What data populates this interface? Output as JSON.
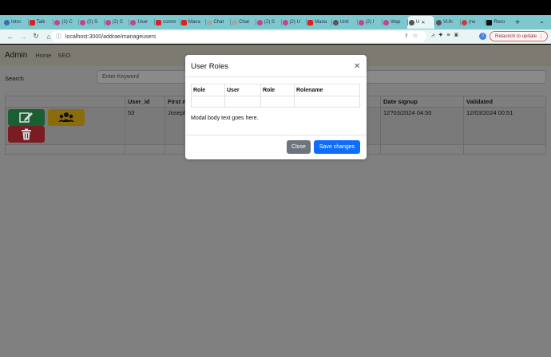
{
  "tabs": [
    {
      "label": "Intro",
      "icon": "globe-icon",
      "color": "#3a6ea5"
    },
    {
      "label": "Talk",
      "icon": "youtube-icon",
      "color": "#e02020"
    },
    {
      "label": "(2) C",
      "icon": "app-icon",
      "color": "#c0468a"
    },
    {
      "label": "(2) S",
      "icon": "app-icon",
      "color": "#c0468a"
    },
    {
      "label": "(2) C",
      "icon": "app-icon",
      "color": "#c0468a"
    },
    {
      "label": "User",
      "icon": "app-icon",
      "color": "#c0468a"
    },
    {
      "label": "comm",
      "icon": "youtube-icon",
      "color": "#e02020"
    },
    {
      "label": "Mana",
      "icon": "youtube-icon",
      "color": "#e02020"
    },
    {
      "label": "Chat",
      "icon": "chat-icon",
      "color": "#9aa"
    },
    {
      "label": "Chat",
      "icon": "chat-icon",
      "color": "#9aa"
    },
    {
      "label": "(2) S",
      "icon": "app-icon",
      "color": "#c0468a"
    },
    {
      "label": "(2) U",
      "icon": "app-icon",
      "color": "#c0468a"
    },
    {
      "label": "Mana",
      "icon": "youtube-icon",
      "color": "#e02020"
    },
    {
      "label": "Unti",
      "icon": "globe-icon",
      "color": "#555"
    },
    {
      "label": "(2) I",
      "icon": "app-icon",
      "color": "#c0468a"
    },
    {
      "label": "Wap",
      "icon": "app-icon",
      "color": "#c0468a"
    },
    {
      "label": "U",
      "icon": "globe-icon",
      "color": "#555",
      "active": true
    },
    {
      "label": "VUh",
      "icon": "globe-icon",
      "color": "#555"
    },
    {
      "label": "(no",
      "icon": "app-icon",
      "color": "#c04040"
    },
    {
      "label": "Reco",
      "icon": "app-icon",
      "color": "#111"
    }
  ],
  "browser": {
    "url": "localhost:3000/addrae/manageusers",
    "relaunch": "Relaunch to update",
    "profile_initial": "J"
  },
  "nav": {
    "brand": "Admin",
    "links": [
      "Home",
      "SEO"
    ]
  },
  "search": {
    "label": "Search",
    "placeholder": "Enter Keyword"
  },
  "table": {
    "headers": [
      "",
      "User_id",
      "First na",
      "Date signup",
      "Validated"
    ],
    "rows": [
      {
        "user_id": "53",
        "first_name": "Joseph",
        "date_signup": "12?03/2024 04:50",
        "validated": "12/03/2024 00:51"
      }
    ]
  },
  "modal": {
    "title": "User Roles",
    "headers": [
      "Role",
      "User",
      "Role",
      "Rolename"
    ],
    "body_text": "Modal body text goes here.",
    "close_label": "Close",
    "save_label": "Save changes"
  },
  "colors": {
    "edit": "#28a745",
    "roles": "#ffc107",
    "delete": "#dc3545",
    "primary": "#0d6efd",
    "secondary": "#6c757d"
  }
}
